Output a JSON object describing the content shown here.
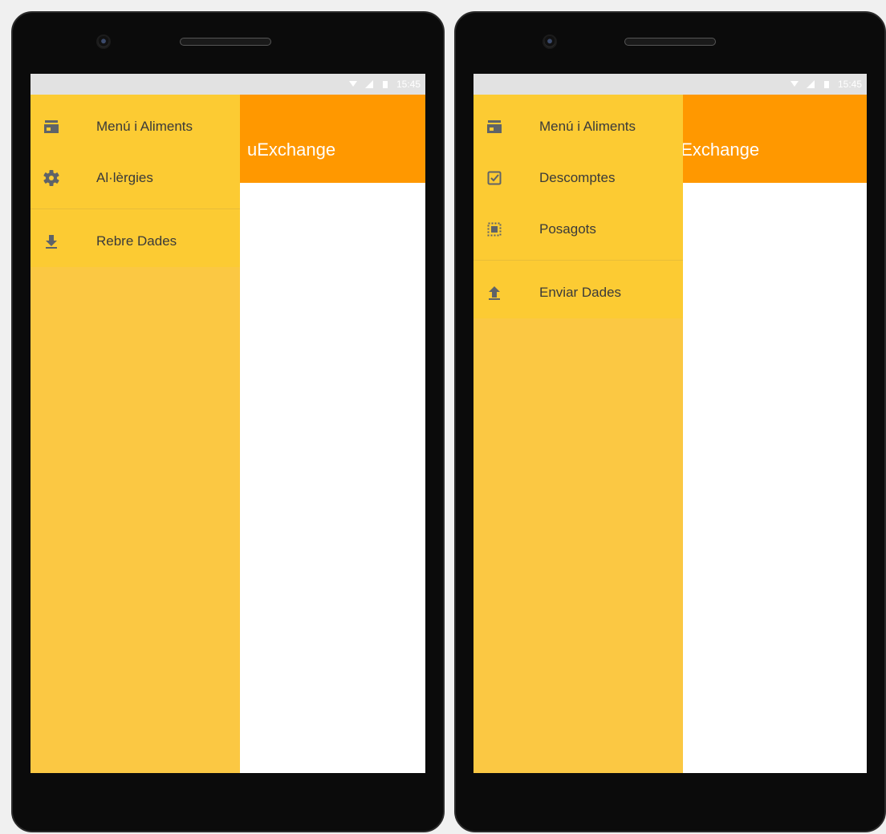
{
  "app": {
    "title": "MenuExchange",
    "visible_title": "uExchange"
  },
  "status_bar": {
    "time": "15:45"
  },
  "colors": {
    "app_bar": "#ff9800",
    "drawer": "#fbc843",
    "drawer_items": "#fccb33",
    "bezel": "#0b0b0b",
    "status_bar": "#e2e2e2"
  },
  "phones": [
    {
      "drawer": {
        "items": [
          {
            "label": "Menú i Aliments",
            "icon": "store-icon"
          },
          {
            "label": "Al·lèrgies",
            "icon": "gear-icon"
          }
        ],
        "footer_items": [
          {
            "label": "Rebre Dades",
            "icon": "download-icon"
          }
        ]
      }
    },
    {
      "drawer": {
        "items": [
          {
            "label": "Menú i Aliments",
            "icon": "store-icon"
          },
          {
            "label": "Descomptes",
            "icon": "checkbox-icon"
          },
          {
            "label": "Posagots",
            "icon": "select-all-icon"
          }
        ],
        "footer_items": [
          {
            "label": "Enviar Dades",
            "icon": "upload-icon"
          }
        ]
      }
    }
  ]
}
